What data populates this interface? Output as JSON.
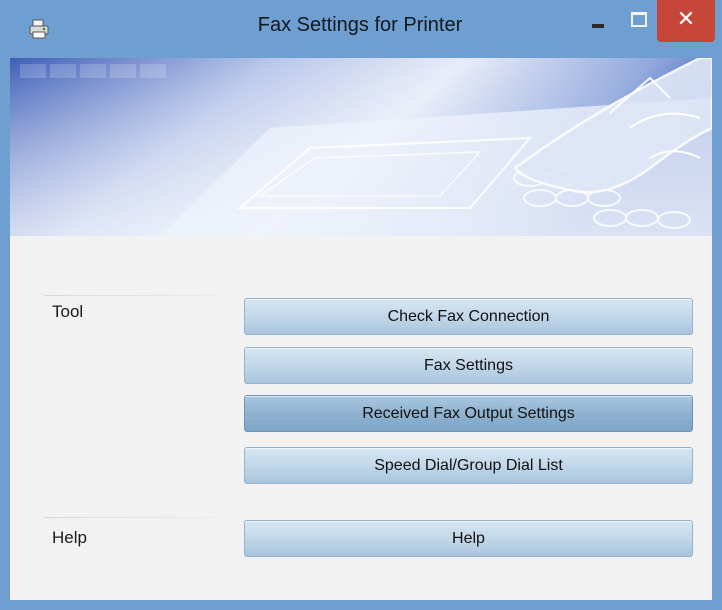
{
  "window": {
    "title": "Fax Settings for Printer",
    "app_icon": "printer-fax-icon",
    "controls": {
      "minimize_icon": "minimize-icon",
      "maximize_icon": "maximize-icon",
      "close_icon": "close-icon",
      "close_glyph": "✕"
    },
    "colors": {
      "titlebar": "#6f9fd0",
      "close_button": "#c7463a",
      "client_bg": "#f2f2f2",
      "button_gradient_top": "#d6e6f2",
      "button_gradient_bottom": "#a9c5dd"
    }
  },
  "banner": {
    "image": "hand-pressing-fax-keypad-illustration"
  },
  "sections": {
    "tool": {
      "label": "Tool",
      "buttons": [
        {
          "label": "Check Fax Connection"
        },
        {
          "label": "Fax Settings"
        },
        {
          "label": "Received Fax Output Settings",
          "state": "hovered"
        },
        {
          "label": "Speed Dial/Group Dial List"
        }
      ]
    },
    "help": {
      "label": "Help",
      "buttons": [
        {
          "label": "Help"
        }
      ]
    }
  }
}
